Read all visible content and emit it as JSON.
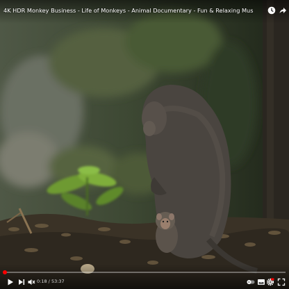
{
  "video": {
    "title": "4K HDR Monkey Business - Life of Monkeys - Animal Documentary - Fun & Relaxing Music Video - No Talk",
    "current_time": "0:18",
    "separator": " / ",
    "duration": "53:37",
    "progress_fraction": 0.0056,
    "accent_color": "#ff0000"
  },
  "icons": {
    "top": [
      "watch-later-clock-icon",
      "share-arrow-icon"
    ],
    "left_controls": [
      "play-icon",
      "next-icon",
      "volume-icon"
    ],
    "right_controls": [
      "autoplay-toggle-icon",
      "subtitles-icon",
      "settings-gear-icon",
      "youtube-logo-icon",
      "fullscreen-icon"
    ]
  }
}
